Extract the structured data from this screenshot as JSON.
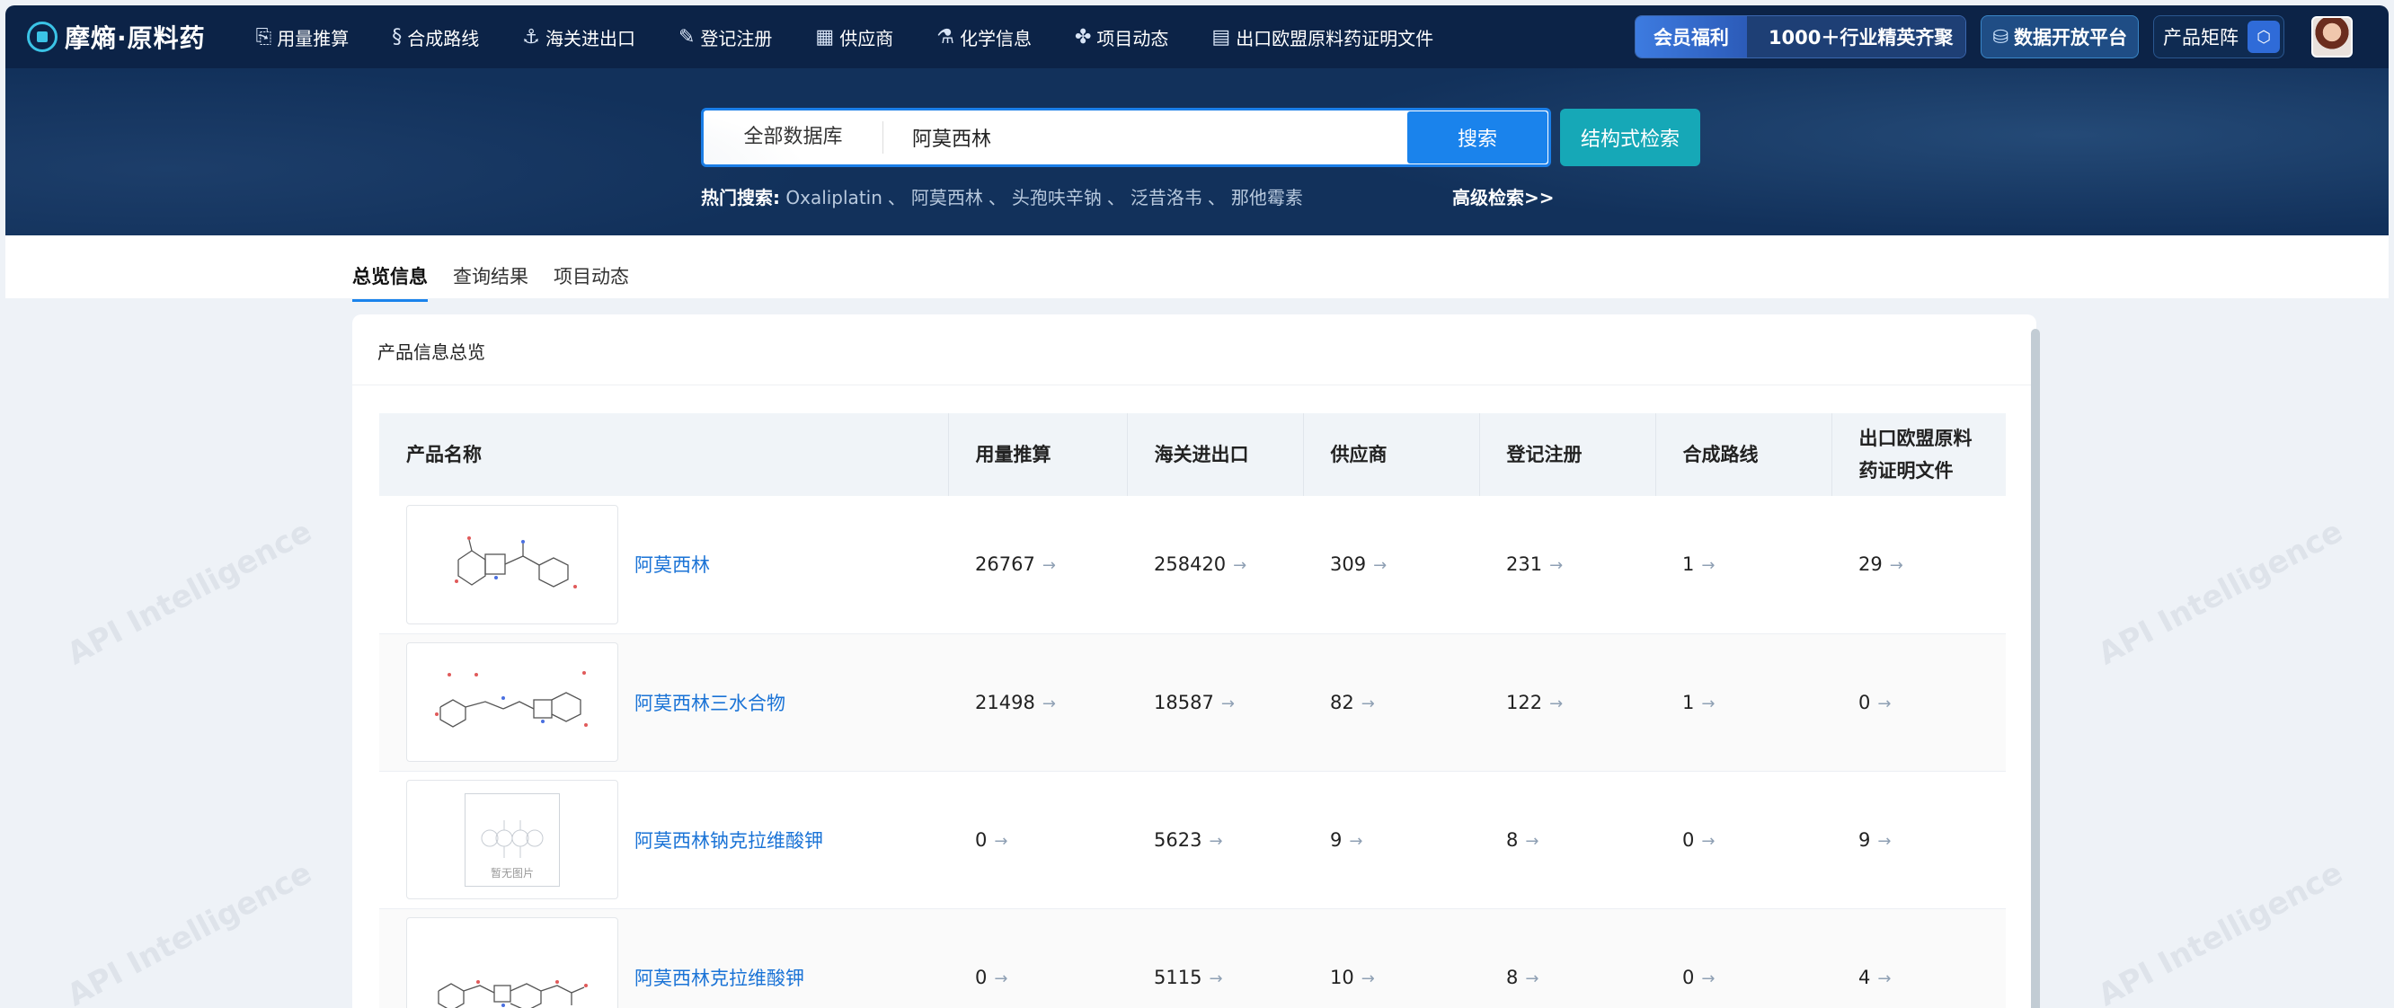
{
  "brand": {
    "name": "摩熵·原料药"
  },
  "nav": {
    "items": [
      {
        "label": "用量推算",
        "icon": "calculator-icon",
        "glyph": "⎘"
      },
      {
        "label": "合成路线",
        "icon": "route-icon",
        "glyph": "§"
      },
      {
        "label": "海关进出口",
        "icon": "anchor-icon",
        "glyph": "⚓"
      },
      {
        "label": "登记注册",
        "icon": "register-icon",
        "glyph": "✎"
      },
      {
        "label": "供应商",
        "icon": "supplier-icon",
        "glyph": "▦"
      },
      {
        "label": "化学信息",
        "icon": "flask-icon",
        "glyph": "⚗"
      },
      {
        "label": "项目动态",
        "icon": "activity-icon",
        "glyph": "✤"
      },
      {
        "label": "出口欧盟原料药证明文件",
        "icon": "document-icon",
        "glyph": "▤"
      }
    ],
    "vip_label": "会员福利",
    "vip_promo": "1000＋行业精英齐聚",
    "data_platform": "数据开放平台",
    "product_matrix": "产品矩阵"
  },
  "search": {
    "scope": "全部数据库",
    "value": "阿莫西林",
    "button": "搜索",
    "structure_button": "结构式检索",
    "hot_label": "热门搜索:",
    "hot_terms": [
      "Oxaliplatin",
      "阿莫西林",
      "头孢呋辛钠",
      "泛昔洛韦",
      "那他霉素"
    ],
    "advanced": "高级检索>>"
  },
  "tabs": [
    {
      "label": "总览信息",
      "active": true
    },
    {
      "label": "查询结果",
      "active": false
    },
    {
      "label": "项目动态",
      "active": false
    }
  ],
  "panel": {
    "title": "产品信息总览",
    "columns": [
      "产品名称",
      "用量推算",
      "海关进出口",
      "供应商",
      "登记注册",
      "合成路线",
      "出口欧盟原料药证明文件"
    ],
    "rows": [
      {
        "name": "阿莫西林",
        "values": [
          "26767",
          "258420",
          "309",
          "231",
          "1",
          "29"
        ],
        "image": "structure"
      },
      {
        "name": "阿莫西林三水合物",
        "values": [
          "21498",
          "18587",
          "82",
          "122",
          "1",
          "0"
        ],
        "image": "structure"
      },
      {
        "name": "阿莫西林钠克拉维酸钾",
        "values": [
          "0",
          "5623",
          "9",
          "8",
          "0",
          "9"
        ],
        "image": "none"
      },
      {
        "name": "阿莫西林克拉维酸钾",
        "values": [
          "0",
          "5115",
          "10",
          "8",
          "0",
          "4"
        ],
        "image": "structure"
      }
    ],
    "no_image_text": "暂无图片",
    "arrow": "→"
  },
  "watermark": "API Intelligence",
  "colors": {
    "nav_bg": "#0c2347",
    "band_bg": "#12315b",
    "accent": "#1a83ec",
    "teal": "#16a8b7",
    "link": "#1a73d6"
  }
}
